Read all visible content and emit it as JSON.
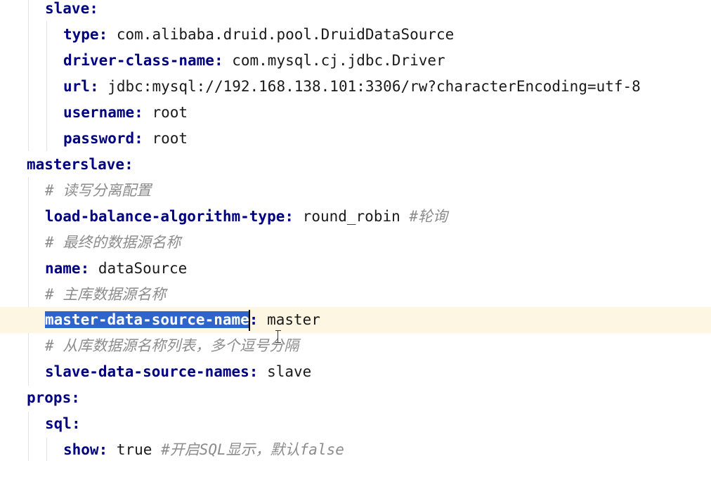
{
  "lines": [
    {
      "key": "slave",
      "sep": ":",
      "value": "",
      "comment": ""
    },
    {
      "key": "type",
      "sep": ": ",
      "value": "com.alibaba.druid.pool.DruidDataSource",
      "comment": ""
    },
    {
      "key": "driver-class-name",
      "sep": ": ",
      "value": "com.mysql.cj.jdbc.Driver",
      "comment": ""
    },
    {
      "key": "url",
      "sep": ": ",
      "value": "jdbc:mysql://192.168.138.101:3306/rw?characterEncoding=utf-8",
      "comment": ""
    },
    {
      "key": "username",
      "sep": ": ",
      "value": "root",
      "comment": ""
    },
    {
      "key": "password",
      "sep": ": ",
      "value": "root",
      "comment": ""
    },
    {
      "key": "masterslave",
      "sep": ":",
      "value": "",
      "comment": ""
    },
    {
      "comment": "# 读写分离配置"
    },
    {
      "key": "load-balance-algorithm-type",
      "sep": ": ",
      "value": "round_robin ",
      "comment": "#轮询"
    },
    {
      "comment": "# 最终的数据源名称"
    },
    {
      "key": "name",
      "sep": ": ",
      "value": "dataSource",
      "comment": ""
    },
    {
      "comment": "# 主库数据源名称"
    },
    {
      "key": "master-data-source-name",
      "sep": ": ",
      "value": "master",
      "comment": ""
    },
    {
      "comment": "# 从库数据源名称列表，多个逗号分隔"
    },
    {
      "key": "slave-data-source-names",
      "sep": ": ",
      "value": "slave",
      "comment": ""
    },
    {
      "key": "props",
      "sep": ":",
      "value": "",
      "comment": ""
    },
    {
      "key": "sql",
      "sep": ":",
      "value": "",
      "comment": ""
    },
    {
      "key": "show",
      "sep": ": ",
      "value": "true ",
      "comment": "#开启SQL显示，默认false"
    }
  ]
}
